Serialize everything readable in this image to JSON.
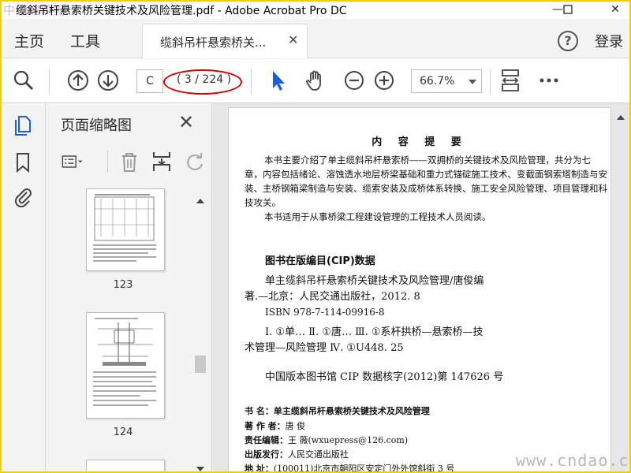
{
  "window": {
    "title": "缆斜吊杆悬索桥关键技术及风险管理.pdf - Adobe Acrobat Pro DC",
    "watermark_logo": "中国建筑网"
  },
  "menu": {
    "home": "主页",
    "tools": "工具",
    "tab_label": "缆斜吊杆悬索桥关...",
    "login": "登录"
  },
  "toolbar": {
    "page_input": "C",
    "page_count": "( 3 / 224 )",
    "zoom": "66.7%"
  },
  "thumb_panel": {
    "title": "页面缩略图",
    "pages": [
      {
        "label": "123"
      },
      {
        "label": "124"
      }
    ]
  },
  "document": {
    "heading": "内 容 提 要",
    "summary_lines": [
      "本书主要介绍了单主缆斜吊杆悬索桥——双拥桥的关键技术及风险管理，共分为七",
      "章，内容包括绪论、溶蚀透水地层桥梁基础和重力式锚碇施工技术、变截面钢索塔制造与安",
      "装、主桥钢箱梁制造与安装、缆索安装及成桥体系转换、施工安全风险管理、项目管理和科",
      "技攻关。"
    ],
    "audience_line": "本书适用于从事桥梁工程建设管理的工程技术人员阅读。",
    "cip_title": "图书在版编目(CIP)数据",
    "cip_lines": [
      "单主缆斜吊杆悬索桥关键技术及风险管理/唐俊编",
      "著.—北京：人民交通出版社，2012. 8",
      "ISBN 978-7-114-09916-8"
    ],
    "class_lines": [
      "Ⅰ. ①单…   Ⅱ. ①唐…   Ⅲ. ①系杆拱桥—悬索桥—技",
      "术管理—风险管理   Ⅳ. ①U448. 25"
    ],
    "cip_number": "中国版本图书馆 CIP 数据核字(2012)第 147626 号",
    "meta": [
      {
        "key": "书      名：",
        "value": "单主缆斜吊杆悬索桥关键技术及风险管理"
      },
      {
        "key": "著 作 者：",
        "value": "唐  俊"
      },
      {
        "key": "责任编辑：",
        "value": "王   薇(wxuepress@126.com)"
      },
      {
        "key": "出版发行：",
        "value": "人民交通出版社"
      },
      {
        "key": "地      址：",
        "value": "(100011)北京市朝阳区安定门外外馆斜街 3 号"
      }
    ]
  },
  "watermark": "www.cndao.com",
  "colors": {
    "accent_blue": "#1e5fcf",
    "annotation_red": "#d40000"
  }
}
